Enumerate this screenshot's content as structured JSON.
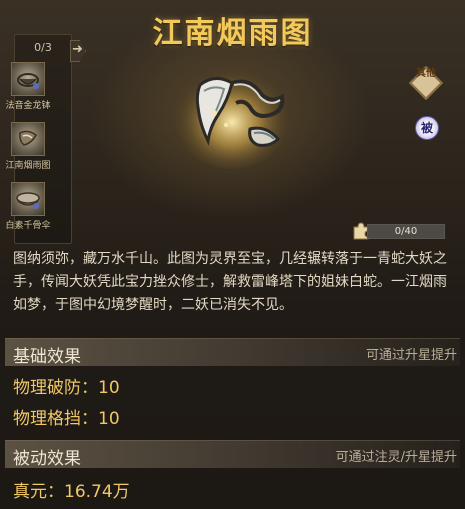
{
  "title": "江南烟雨图",
  "set": {
    "count": "0/3",
    "arrow": "➜",
    "items": [
      {
        "label": "法音金龙钵"
      },
      {
        "label": "江南烟雨图"
      },
      {
        "label": "白素千骨伞"
      }
    ]
  },
  "tags": {
    "qi": "其他",
    "bei": "被"
  },
  "fragments": {
    "text": "0/40",
    "fraction": 0.0
  },
  "description": "图纳须弥，藏万水千山。此图为灵界至宝，几经辗转落于一青蛇大妖之手，传闻大妖凭此宝力挫众修士，解救雷峰塔下的姐妹白蛇。一江烟雨如梦，于图中幻境梦醒时，二妖已消失不见。",
  "base_effects": {
    "title": "基础效果",
    "hint": "可通过升星提升",
    "stats": [
      "物理破防：10",
      "物理格挡：10"
    ]
  },
  "passive_effects": {
    "title": "被动效果",
    "hint": "可通过注灵/升星提升",
    "stats": [
      "真元：16.74万"
    ]
  }
}
